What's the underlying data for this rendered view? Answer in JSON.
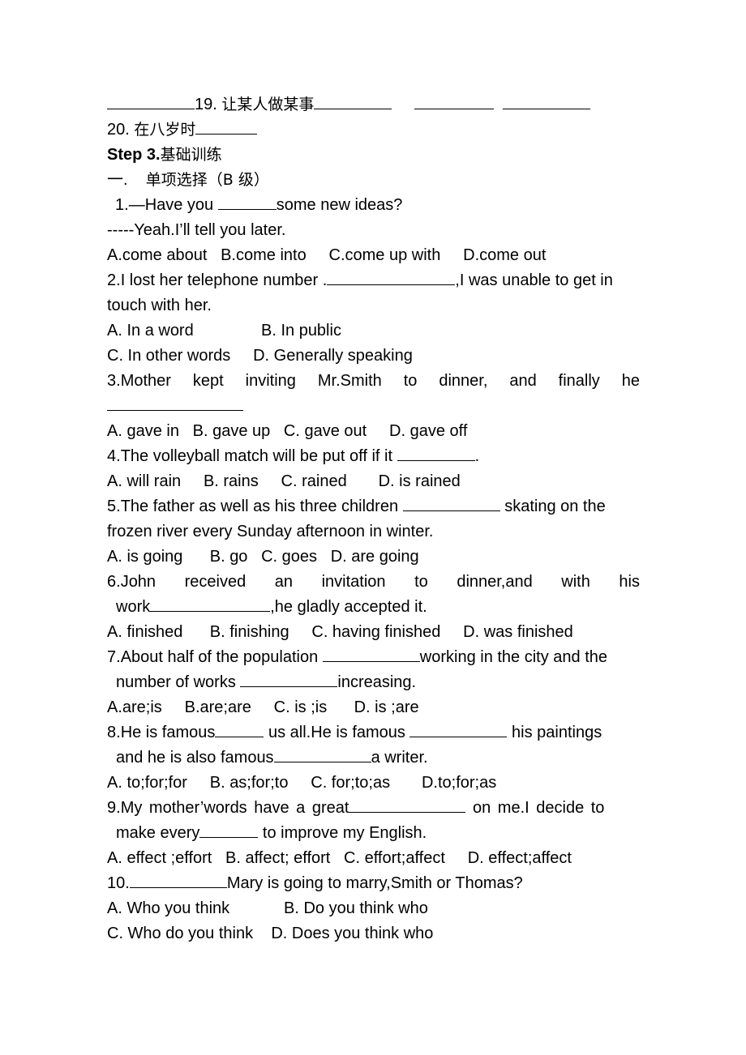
{
  "vocab": {
    "item19": {
      "number": "19.",
      "text": "让某人做某事"
    },
    "item20": {
      "number": "20.",
      "text": "在八岁时"
    }
  },
  "section": {
    "step_label": "Step 3.",
    "step_title": "基础训练",
    "part_number": "一.",
    "part_title": "单项选择（B 级）"
  },
  "questions": [
    {
      "number": "1.",
      "lines": [
        "—Have you ",
        "some new ideas?"
      ],
      "reply": "-----Yeah.I’ll tell you later.",
      "options": [
        "A.come about",
        "B.come into",
        "C.come up with",
        "D.come out"
      ]
    },
    {
      "number": "2.",
      "lines": [
        "I lost her telephone number .",
        ",I was unable to get in",
        "touch with her."
      ],
      "options": [
        "A. In a word",
        "B. In public",
        "C. In other words",
        "D. Generally speaking"
      ]
    },
    {
      "number": "3.",
      "lines": [
        "Mother kept inviting Mr.Smith to dinner, and finally he"
      ],
      "options": [
        "A. gave in",
        "B. gave up",
        "C. gave out",
        "D. gave off"
      ]
    },
    {
      "number": "4.",
      "lines": [
        "The volleyball match will be put off if it ",
        "."
      ],
      "options": [
        "A. will rain",
        "B. rains",
        "C. rained",
        "D. is rained"
      ]
    },
    {
      "number": "5.",
      "lines": [
        "The father as well as his three children ",
        " skating on the",
        "frozen river every Sunday afternoon in winter."
      ],
      "options": [
        "A. is going",
        "B. go",
        "C. goes",
        "D. are going"
      ]
    },
    {
      "number": "6.",
      "lines": [
        "John received an invitation to dinner,and with his",
        "work",
        ",he gladly accepted it."
      ],
      "options": [
        "A. finished",
        "B. finishing",
        "C. having finished",
        "D. was finished"
      ]
    },
    {
      "number": "7.",
      "lines": [
        "About half of the population ",
        "working in the city and the",
        "number of works ",
        "increasing."
      ],
      "options": [
        "A.are;is",
        "B.are;are",
        "C. is ;is",
        "D. is ;are"
      ]
    },
    {
      "number": "8.",
      "lines": [
        "He is famous",
        " us all.He is famous ",
        " his paintings",
        "and he is also famous",
        "a writer."
      ],
      "options": [
        "A. to;for;for",
        "B. as;for;to",
        "C. for;to;as",
        "D.to;for;as"
      ]
    },
    {
      "number": "9.",
      "lines": [
        "My mother’words have a great",
        " on me.I decide to",
        "make every",
        " to improve my English."
      ],
      "options": [
        "A. effect ;effort",
        "B. affect; effort",
        "C. effort;affect",
        "D. effect;affect"
      ]
    },
    {
      "number": "10.",
      "lines": [
        "Mary is going to marry,Smith or Thomas?"
      ],
      "options": [
        "A. Who you think",
        "B. Do you think who",
        "C. Who do you think",
        "D. Does you think who"
      ]
    }
  ]
}
